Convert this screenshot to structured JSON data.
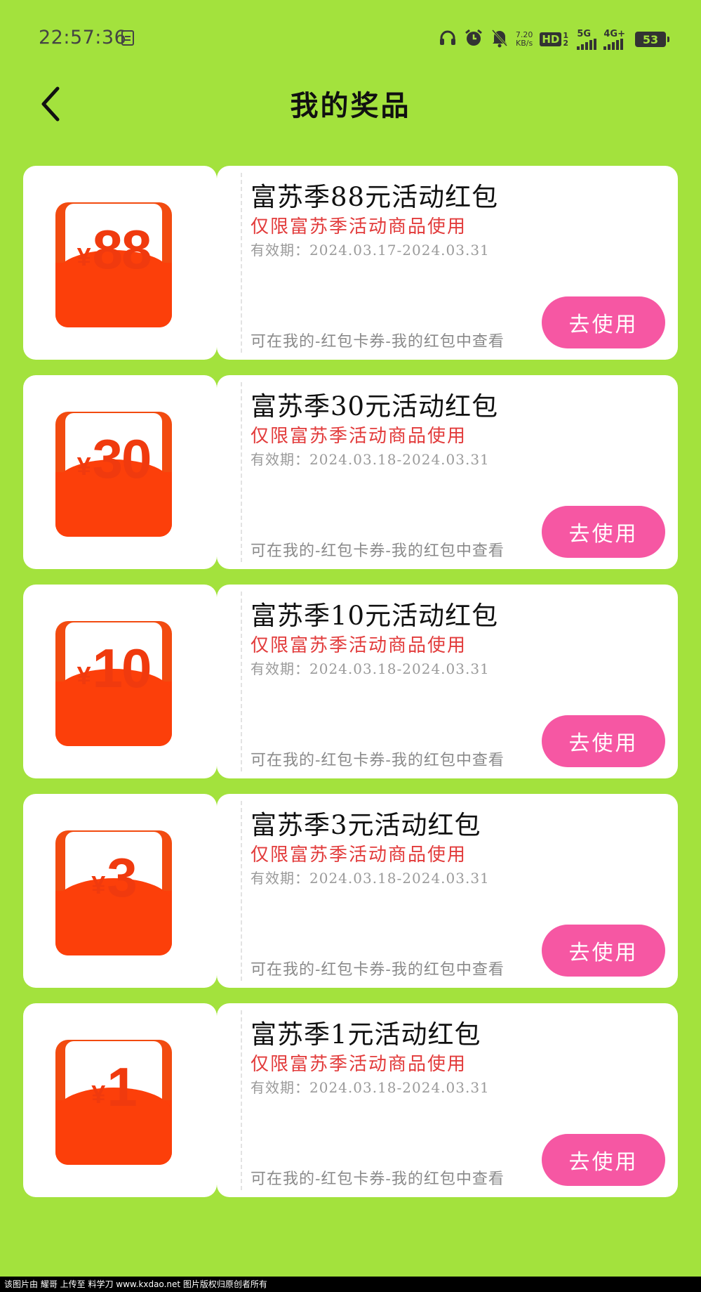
{
  "status_bar": {
    "time": "22:57:36",
    "net_speed_value": "7.20",
    "net_speed_unit": "KB/s",
    "hd_label": "HD",
    "hd_sub": "1 2",
    "signal1_label": "5G",
    "signal2_label": "4G+",
    "battery": "53",
    "icons": [
      "document-icon",
      "headset-icon",
      "alarm-icon",
      "mute-bell-icon",
      "signal-icon",
      "battery-icon"
    ]
  },
  "header": {
    "title": "我的奖品",
    "back_icon": "chevron-left-icon"
  },
  "prizes": [
    {
      "amount": "88",
      "yen": "¥",
      "title": "富苏季88元活动红包",
      "restriction": "仅限富苏季活动商品使用",
      "validity": "有效期：2024.03.17-2024.03.31",
      "hint": "可在我的-红包卡券-我的红包中查看",
      "button": "去使用"
    },
    {
      "amount": "30",
      "yen": "¥",
      "title": "富苏季30元活动红包",
      "restriction": "仅限富苏季活动商品使用",
      "validity": "有效期：2024.03.18-2024.03.31",
      "hint": "可在我的-红包卡券-我的红包中查看",
      "button": "去使用"
    },
    {
      "amount": "10",
      "yen": "¥",
      "title": "富苏季10元活动红包",
      "restriction": "仅限富苏季活动商品使用",
      "validity": "有效期：2024.03.18-2024.03.31",
      "hint": "可在我的-红包卡券-我的红包中查看",
      "button": "去使用"
    },
    {
      "amount": "3",
      "yen": "¥",
      "title": "富苏季3元活动红包",
      "restriction": "仅限富苏季活动商品使用",
      "validity": "有效期：2024.03.18-2024.03.31",
      "hint": "可在我的-红包卡券-我的红包中查看",
      "button": "去使用"
    },
    {
      "amount": "1",
      "yen": "¥",
      "title": "富苏季1元活动红包",
      "restriction": "仅限富苏季活动商品使用",
      "validity": "有效期：2024.03.18-2024.03.31",
      "hint": "可在我的-红包卡券-我的红包中查看",
      "button": "去使用"
    }
  ],
  "colors": {
    "background": "#a3e23d",
    "button": "#f657a3",
    "restriction_text": "#e23b3b",
    "envelope": "#fc3f0a"
  },
  "watermark": "该图片由 耀哥 上传至 料学刀 www.kxdao.net 图片版权归原创者所有"
}
